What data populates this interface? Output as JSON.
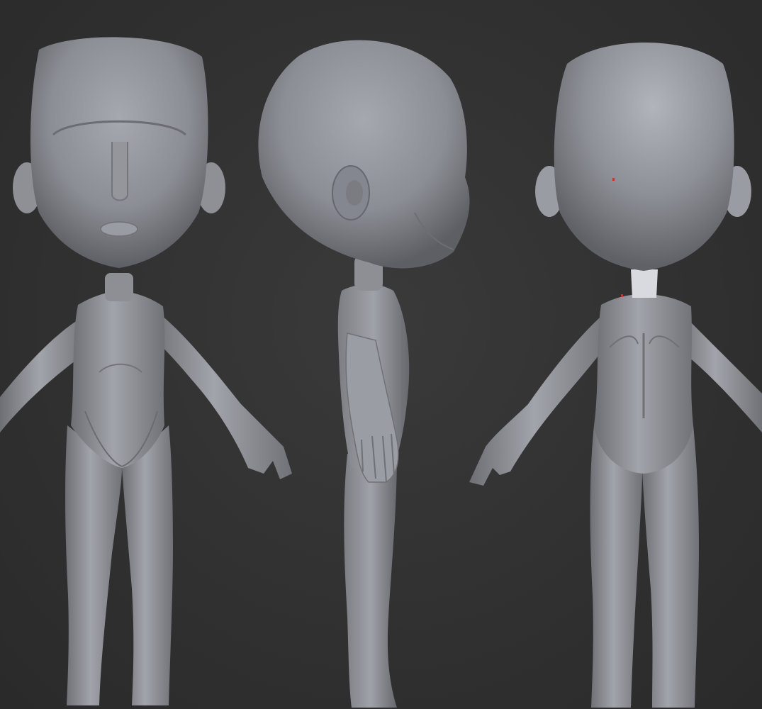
{
  "viewport": {
    "background_color": "#303030",
    "model_color": "#8e9096",
    "views": [
      {
        "name": "front",
        "label": ""
      },
      {
        "name": "side",
        "label": ""
      },
      {
        "name": "back",
        "label": ""
      }
    ]
  }
}
